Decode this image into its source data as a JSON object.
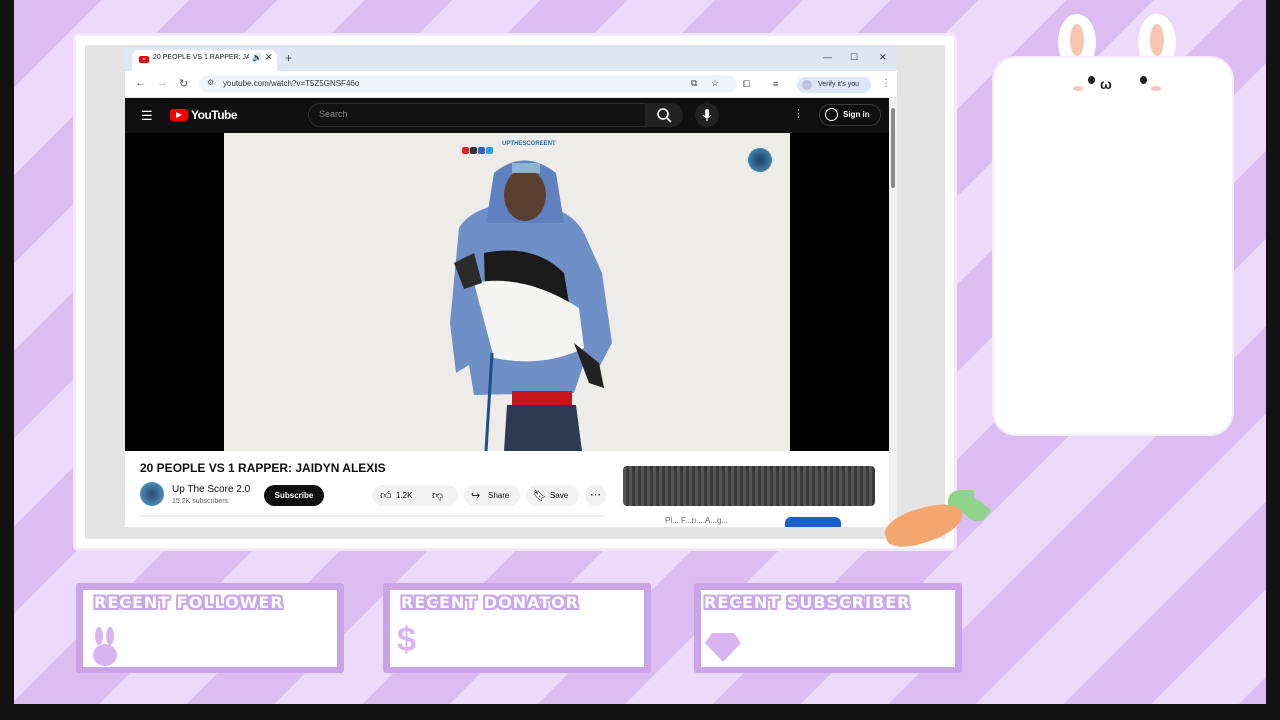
{
  "browser": {
    "tab_title": "20 PEOPLE VS 1 RAPPER: JAIDYN ALEXIS",
    "new_tab_symbol": "+",
    "url": "youtube.com/watch?v=T5Z5GNSF46o",
    "verify_label": "Verify it's you"
  },
  "youtube": {
    "logo_text": "YouTube",
    "search_placeholder": "Search",
    "sign_in_label": "Sign in",
    "video": {
      "watermark": "UPTHESCOREENT",
      "title": "20 PEOPLE VS 1 RAPPER: JAIDYN ALEXIS",
      "channel": "Up The Score 2.0",
      "subscribers": "15.2K subscribers",
      "subscribe_label": "Subscribe",
      "likes": "1.2K",
      "share_label": "Share",
      "save_label": "Save"
    },
    "sidebar_partial_text": "Pl... F...n ...A...g..."
  },
  "overlay": {
    "recent_follower": "RECENT FOLLOWER",
    "recent_donator": "RECENT DONATOR",
    "recent_subscriber": "RECENT SUBSCRIBER",
    "donator_symbol": "$"
  },
  "colors": {
    "stripe_dark": "#dcbdf2",
    "stripe_light": "#edd9fb",
    "alert_border": "#c9a4e6",
    "youtube_red": "#ff0000"
  }
}
